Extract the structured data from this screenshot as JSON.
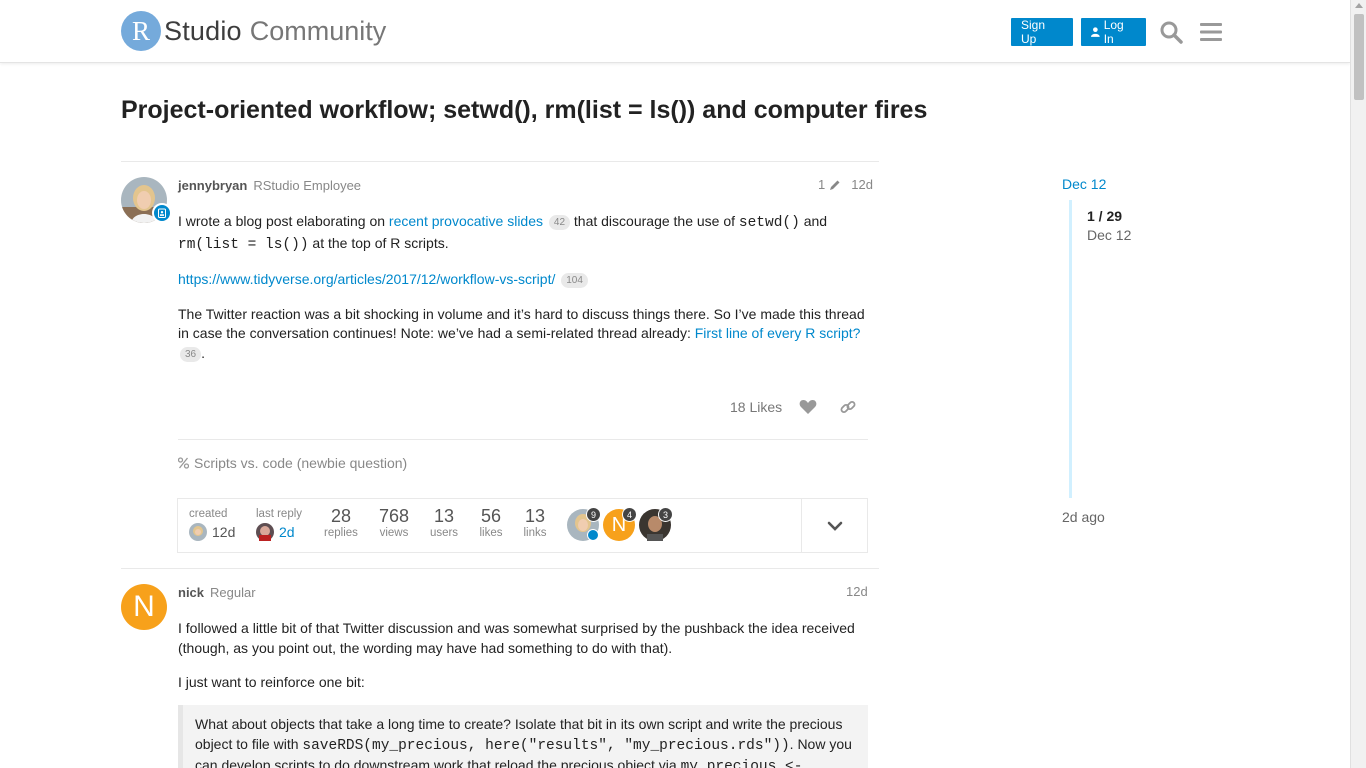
{
  "header": {
    "logo_letter": "R",
    "logo_word1": "Studio",
    "logo_word2": "Community",
    "signup_label": "Sign Up",
    "login_label": "Log In",
    "accent_color": "#0088cc"
  },
  "topic": {
    "title": "Project-oriented workflow; setwd(), rm(list = ls()) and computer fires"
  },
  "post1": {
    "username": "jennybryan",
    "user_title": "RStudio Employee",
    "edit_count": "1",
    "age": "12d",
    "p1_text1": "I wrote a blog post elaborating on ",
    "p1_link": "recent provocative slides",
    "p1_link_clicks": "42",
    "p1_text2": " that discourage the use of ",
    "p1_code1": "setwd()",
    "p1_text3": " and",
    "p1_code2": "rm(list = ls())",
    "p1_text4": " at the top of R scripts.",
    "p2_link": "https://www.tidyverse.org/articles/2017/12/workflow-vs-script/",
    "p2_link_clicks": "104",
    "p3_text1": "The Twitter reaction was a bit shocking in volume and it’s hard to discuss things there. So I’ve made this thread in case the conversation continues! Note: we’ve had a semi-related thread already: ",
    "p3_link": "First line of every R script?",
    "p3_link_clicks": "36",
    "p3_text2": ".",
    "likes": "18 Likes",
    "linked_topic": "Scripts vs. code (newbie question)"
  },
  "topic_map": {
    "created_label": "created",
    "created_value": "12d",
    "last_reply_label": "last reply",
    "last_reply_value": "2d",
    "stats": [
      {
        "num": "28",
        "label": "replies"
      },
      {
        "num": "768",
        "label": "views"
      },
      {
        "num": "13",
        "label": "users"
      },
      {
        "num": "56",
        "label": "likes"
      },
      {
        "num": "13",
        "label": "links"
      }
    ],
    "participants": [
      {
        "count": "9"
      },
      {
        "letter": "N",
        "count": "4"
      },
      {
        "count": "3"
      }
    ]
  },
  "post2": {
    "avatar_letter": "N",
    "username": "nick",
    "user_title": "Regular",
    "age": "12d",
    "p1": "I followed a little bit of that Twitter discussion and was somewhat surprised by the pushback the idea received (though, as you point out, the wording may have had something to do with that).",
    "p2": "I just want to reinforce one bit:",
    "quote_text1": "What about objects that take a long time to create? Isolate that bit in its own script and write the precious object to file with ",
    "quote_code1": "saveRDS(my_precious, here(\"results\", \"my_precious.rds\"))",
    "quote_text2": ". Now you can develop scripts to do downstream work that reload the precious object via ",
    "quote_code2": "my_precious <-"
  },
  "timeline": {
    "start_date": "Dec 12",
    "position": "1 / 29",
    "position_date": "Dec 12",
    "end_label": "2d ago"
  }
}
